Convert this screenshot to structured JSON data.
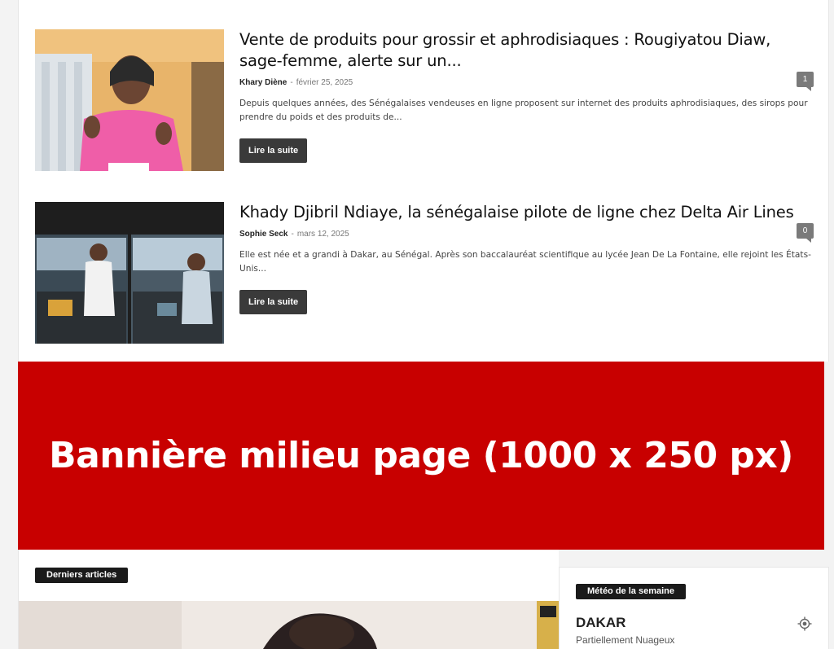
{
  "articles": [
    {
      "title": "Vente de produits pour grossir et aphrodisiaques : Rougiyatou Diaw, sage-femme, alerte sur un...",
      "author": "Khary Diène",
      "date": "février 25, 2025",
      "comments": "1",
      "excerpt": "Depuis quelques années, des Sénégalaises vendeuses en ligne proposent sur internet des produits aphrodisiaques, des sirops pour prendre du poids et des produits de...",
      "read_more": "Lire la suite"
    },
    {
      "title": "Khady Djibril Ndiaye, la sénégalaise pilote de ligne chez Delta Air Lines",
      "author": "Sophie Seck",
      "date": "mars 12, 2025",
      "comments": "0",
      "excerpt": "Elle est née et a grandi à Dakar, au Sénégal. Après son baccalauréat scientifique au lycée Jean De La Fontaine, elle rejoint les États-Unis...",
      "read_more": "Lire la suite"
    }
  ],
  "meta_separator": "-",
  "banner": {
    "text": "Bannière milieu page (1000 x 250 px)",
    "color": "#c80000"
  },
  "latest": {
    "label": "Derniers articles"
  },
  "weather": {
    "label": "Météo de la semaine",
    "city": "DAKAR",
    "condition": "Partiellement Nuageux",
    "locate_icon": "locate-icon"
  }
}
